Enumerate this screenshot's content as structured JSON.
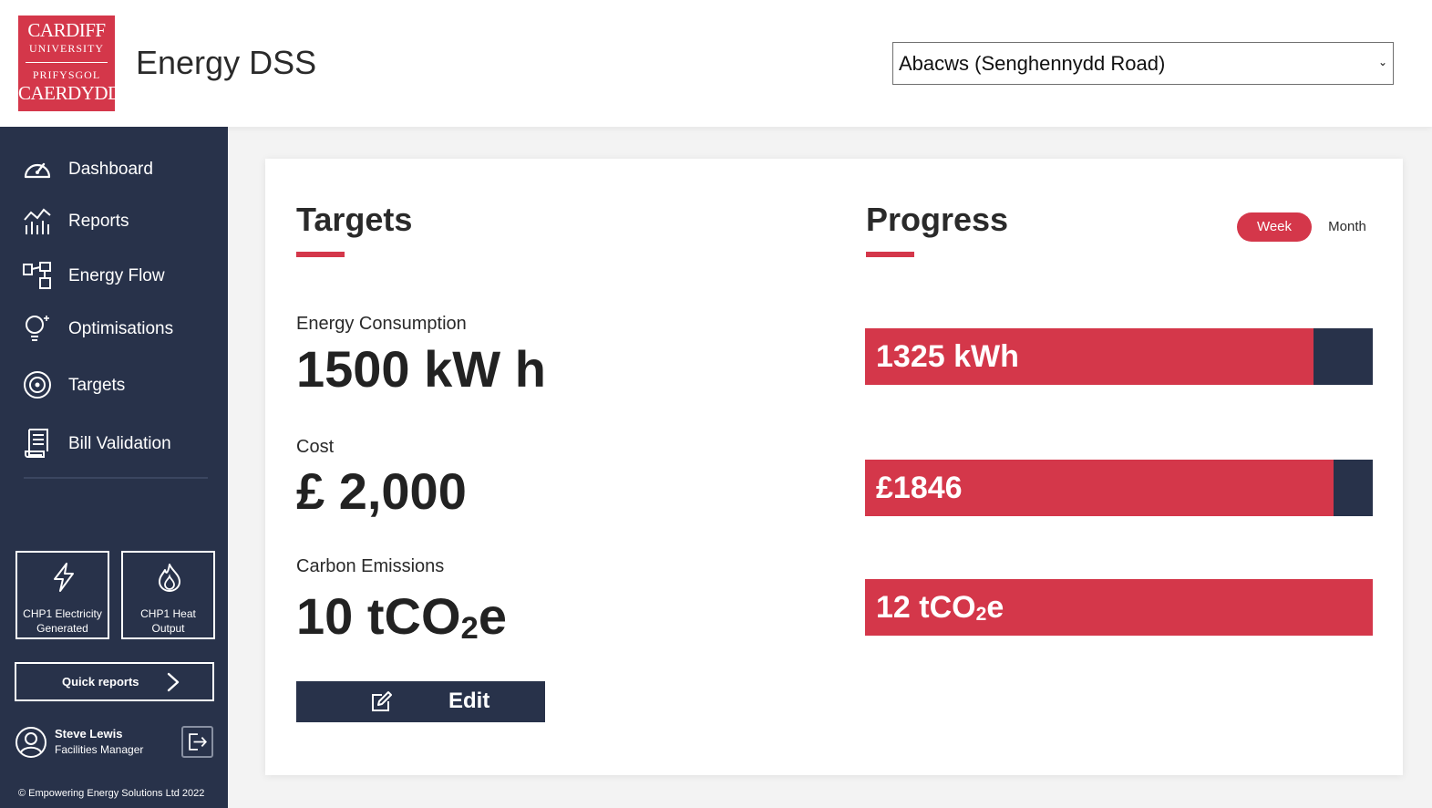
{
  "header": {
    "logo_lines": [
      "CARDIFF",
      "UNIVERSITY",
      "PRIFYSGOL",
      "CAERDYDD"
    ],
    "app_title": "Energy DSS",
    "building_select": "Abacws (Senghennydd Road)"
  },
  "sidebar": {
    "items": [
      {
        "label": "Dashboard",
        "icon": "gauge-icon"
      },
      {
        "label": "Reports",
        "icon": "chart-icon"
      },
      {
        "label": "Energy Flow",
        "icon": "flow-icon"
      },
      {
        "label": "Optimisations",
        "icon": "bulb-icon"
      },
      {
        "label": "Targets",
        "icon": "target-icon"
      },
      {
        "label": "Bill Validation",
        "icon": "receipt-icon"
      }
    ],
    "tiles": [
      {
        "label": "CHP1 Electricity Generated",
        "icon": "lightning-icon"
      },
      {
        "label": "CHP1 Heat Output",
        "icon": "flame-icon"
      }
    ],
    "quick_reports": "Quick reports",
    "user": {
      "name": "Steve Lewis",
      "role": "Facilities Manager"
    },
    "copyright": "© Empowering Energy Solutions Ltd 2022"
  },
  "targets": {
    "title": "Targets",
    "metrics": [
      {
        "label": "Energy Consumption",
        "value": "1500 kW h"
      },
      {
        "label": "Cost",
        "value": "£ 2,000"
      },
      {
        "label": "Carbon Emissions",
        "value": "10 tCO",
        "value_sub": "2",
        "value_suffix": "e"
      }
    ],
    "edit_label": "Edit"
  },
  "progress": {
    "title": "Progress",
    "period_options": [
      "Week",
      "Month"
    ],
    "selected_period": "Week",
    "bars": [
      {
        "label": "1325 kWh",
        "fraction": 0.8833
      },
      {
        "label": "£1846",
        "fraction": 0.923
      },
      {
        "label": "12 tCO",
        "label_sub": "2",
        "label_suffix": "e",
        "fraction": 1.0
      }
    ]
  },
  "colors": {
    "accent": "#d4374a",
    "navy": "#28324a"
  }
}
